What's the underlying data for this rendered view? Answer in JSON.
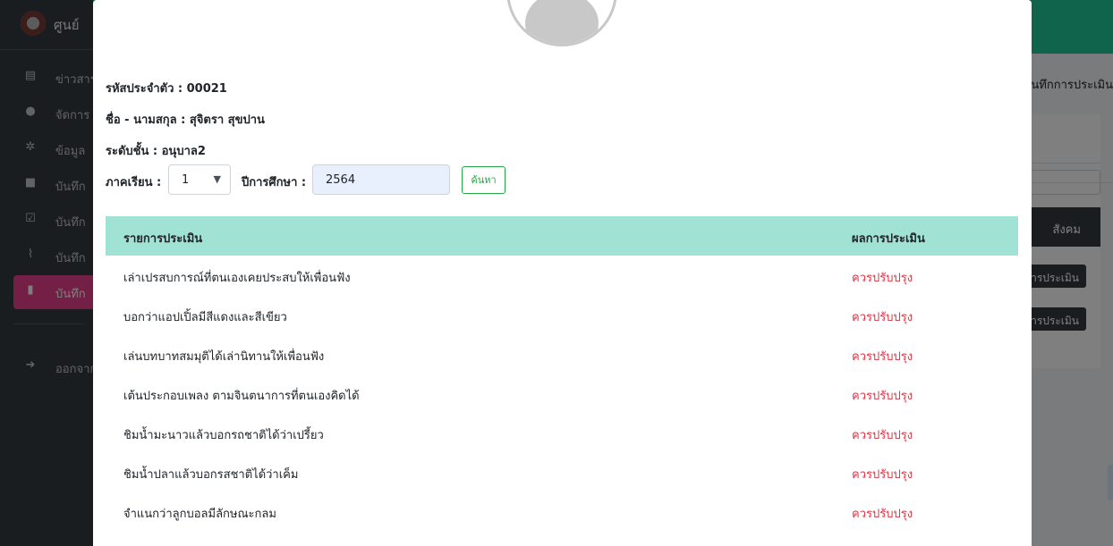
{
  "background": {
    "sidebar": {
      "brand_text": "ศูนย์",
      "items": [
        {
          "icon": "newspaper-icon",
          "glyph": "▤",
          "label": "ข่าวสาร"
        },
        {
          "icon": "user-circle-icon",
          "glyph": "●",
          "label": "จัดการ"
        },
        {
          "icon": "child-icon",
          "glyph": "✲",
          "label": "ข้อมูล"
        },
        {
          "icon": "wallet-icon",
          "glyph": "■",
          "label": "บันทึก"
        },
        {
          "icon": "calendar-check-icon",
          "glyph": "☑",
          "label": "บันทึก"
        },
        {
          "icon": "chart-line-icon",
          "glyph": "⌇",
          "label": "บันทึก"
        },
        {
          "icon": "clipboard-icon",
          "glyph": "▮",
          "label": "บันทึก"
        },
        {
          "icon": "sign-out-icon",
          "glyph": "➜",
          "label": "ออกจาก"
        }
      ]
    },
    "header_text": "บันทึกการประเมิน",
    "table_head_text": "สังคม",
    "row_buttons": [
      "การประเมิน",
      "การประเมิน"
    ]
  },
  "modal": {
    "student_id_label": "รหัสประจำตัว : 00021",
    "name_label": "ชื่อ - นามสกุล : สุจิตรา สุขปาน",
    "level_label": "ระดับชั้น : อนุบาล2",
    "term_label": "ภาคเรียน :",
    "term_value": "1",
    "year_label": "ปีการศึกษา :",
    "year_value": "2564",
    "search_button": "ค้นหา",
    "table": {
      "headers": [
        "รายการประเมิน",
        "ผลการประเมิน"
      ],
      "rows": [
        {
          "item": "เล่าเปรสบการณ์ที่ตนเองเคยประสบให้เพื่อนฟัง",
          "result": "ควรปรับปรุง"
        },
        {
          "item": "บอกว่าแอปเปิ้ลมีสีแดงและสีเขียว",
          "result": "ควรปรับปรุง"
        },
        {
          "item": "เล่นบทบาทสมมุติได้เล่านิทานให้เพื่อนฟัง",
          "result": "ควรปรับปรุง"
        },
        {
          "item": "เต้นประกอบเพลง ตามจินตนาการที่ตนเองคิดได้",
          "result": "ควรปรับปรุง"
        },
        {
          "item": "ชิมน้ำมะนาวแล้วบอกรถชาติได้ว่าเปรี้ยว",
          "result": "ควรปรับปรุง"
        },
        {
          "item": "ชิมน้ำปลาแล้วบอกรสชาติได้ว่าเค็ม",
          "result": "ควรปรับปรุง"
        },
        {
          "item": "จำแนกว่าลูกบอลมีลักษณะกลม",
          "result": "ควรปรับปรุง"
        }
      ]
    }
  },
  "colors": {
    "sidebar_bg": "#343a40",
    "active_item": "#e83e8c",
    "topbar": "#20c997",
    "table_header": "#a0e3d5",
    "result_text": "#dc3545",
    "search_button": "#28a745"
  }
}
